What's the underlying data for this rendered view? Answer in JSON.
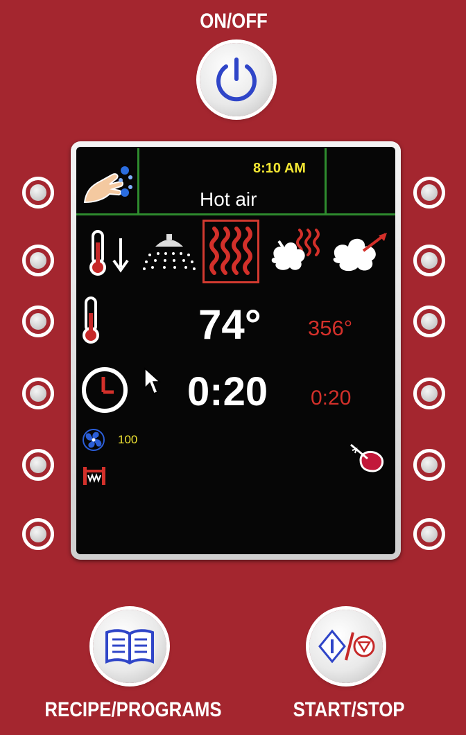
{
  "panel": {
    "on_off_label": "ON/OFF",
    "recipe_label": "RECIPE/PROGRAMS",
    "start_stop_label": "START/STOP"
  },
  "screen": {
    "clock": "8:10 AM",
    "mode": "Hot air",
    "modes": [
      "cool-down",
      "humidify",
      "hot-air",
      "combi",
      "steam"
    ],
    "selected_mode": "hot-air",
    "temperature": {
      "actual": "74°",
      "set": "356°"
    },
    "time": {
      "actual": "0:20",
      "set": "0:20"
    },
    "fan_speed": "100"
  },
  "colors": {
    "panel": "#a4262f",
    "grid_line": "#2e8b2e",
    "clock_text": "#f2e633",
    "setpoint_text": "#d3302a",
    "selection": "#d33a30",
    "power_icon": "#2f45c8"
  }
}
